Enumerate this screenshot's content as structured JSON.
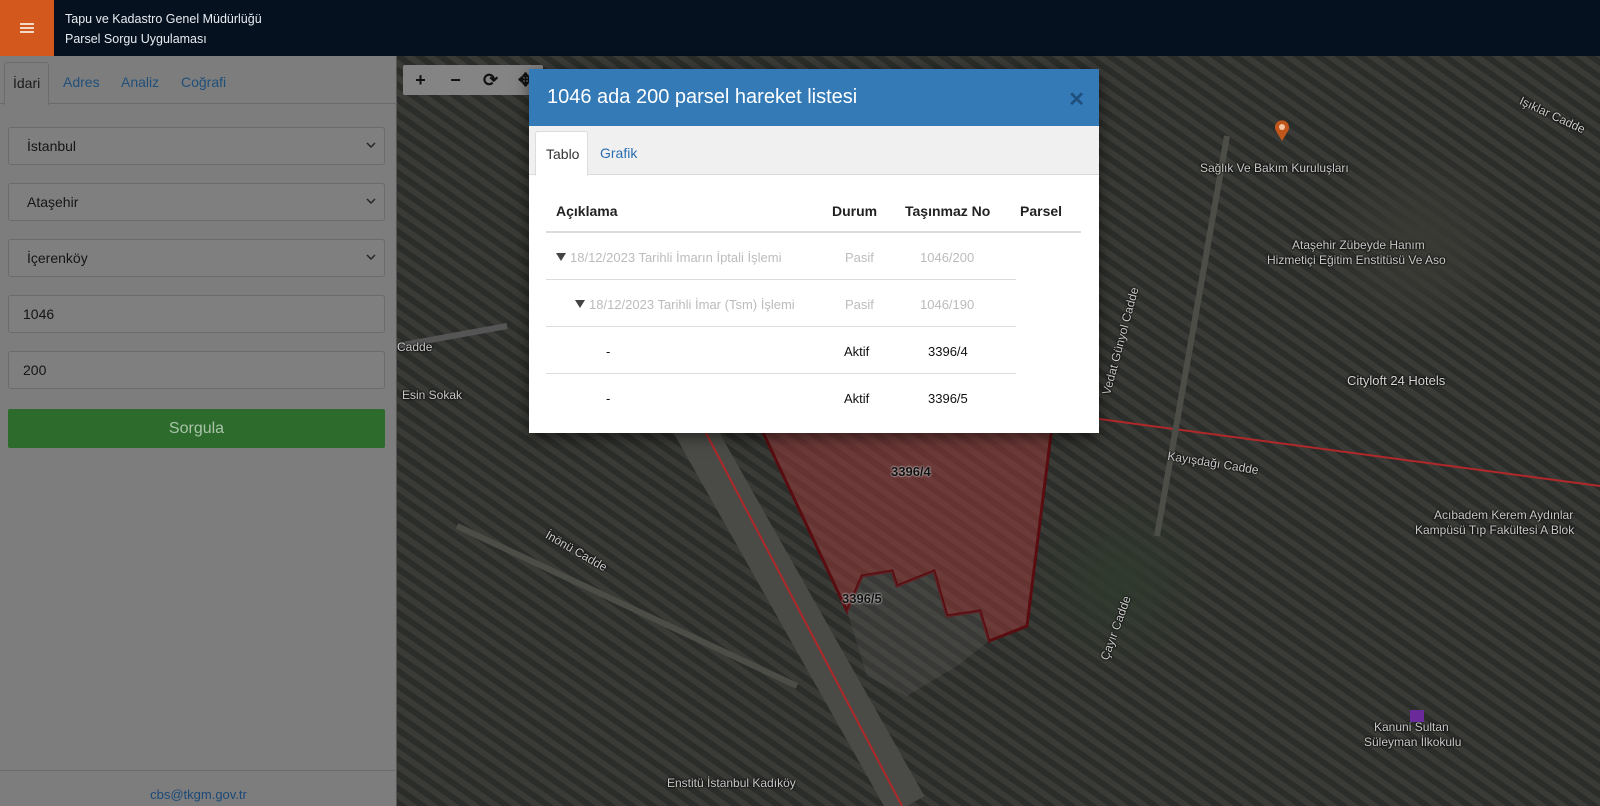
{
  "header": {
    "line1": "Tapu ve Kadastro Genel Müdürlüğü",
    "line2": "Parsel Sorgu Uygulaması",
    "menu_icon": "hamburger-icon"
  },
  "sidebar": {
    "tabs": [
      {
        "label": "İdari",
        "active": true
      },
      {
        "label": "Adres",
        "active": false
      },
      {
        "label": "Analiz",
        "active": false
      },
      {
        "label": "Coğrafi",
        "active": false
      }
    ],
    "il": "İstanbul",
    "ilce": "Ataşehir",
    "mahalle": "İçerenköy",
    "ada": "1046",
    "parsel": "200",
    "button_label": "Sorgula",
    "footer_email": "cbs@tkgm.gov.tr"
  },
  "map": {
    "tools": [
      "+",
      "−",
      "⟳",
      "✥"
    ],
    "labels": {
      "saglik": "Sağlık Ve Bakım Kuruluşları",
      "atasehir1": "Ataşehir Zübeyde Hanım",
      "atasehir2": "Hizmetiçi Eğitim Enstitüsü Ve Aso",
      "cityloft": "Cityloft 24 Hotels",
      "kayisdagi": "Kayışdağı Cadde",
      "acibadem1": "Acıbadem Kerem Aydınlar",
      "acibadem2": "Kampüsü Tıp Fakültesi A Blok",
      "kanuni1": "Kanuni Sultan",
      "kanuni2": "Süleyman İlkokulu",
      "inonu": "İnönü Cadde",
      "esin": "Esin Sokak",
      "cadde": "Cadde",
      "enstitu": "Enstitü İstanbul Kadıköy",
      "parcel1": "3396/4",
      "parcel2": "3396/5",
      "cayir": "Çayır Cadde",
      "veysel": "Vedat Günyol Cadde",
      "ikilar": "Işıklar Cadde"
    }
  },
  "modal": {
    "title": "1046 ada 200 parsel hareket listesi",
    "close_icon": "close-icon",
    "tabs": [
      "Tablo",
      "Grafik"
    ],
    "columns": [
      "Açıklama",
      "Durum",
      "Taşınmaz No",
      "Parsel"
    ],
    "rows": [
      {
        "aciklama": "18/12/2023 Tarihli İmarın İptali İşlemi",
        "durum": "Pasif",
        "tasinmaz_no": "1046/200",
        "level": 0,
        "faded": true
      },
      {
        "aciklama": "18/12/2023 Tarihli İmar (Tsm) İşlemi",
        "durum": "Pasif",
        "tasinmaz_no": "1046/190",
        "level": 1,
        "faded": true
      },
      {
        "aciklama": "-",
        "durum": "Aktif",
        "tasinmaz_no": "3396/4",
        "level": 2,
        "faded": false
      },
      {
        "aciklama": "-",
        "durum": "Aktif",
        "tasinmaz_no": "3396/5",
        "level": 2,
        "faded": false
      }
    ]
  },
  "colors": {
    "header_bg": "#06111f",
    "menu_orange": "#d2581e",
    "modal_blue": "#337ab7",
    "button_green": "#2c6b2c",
    "parcel_red": "#b0282a"
  }
}
